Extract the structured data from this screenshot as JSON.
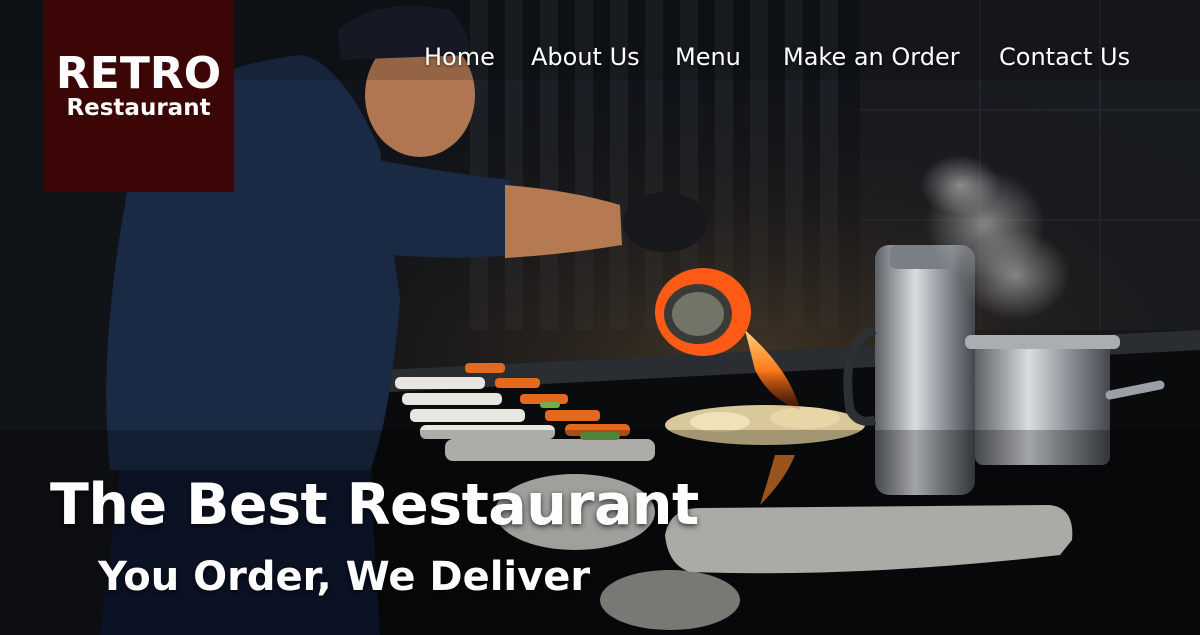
{
  "brand": {
    "line1": "RETRO",
    "line2": "Restaurant",
    "background": "#3d0606"
  },
  "nav": {
    "items": [
      {
        "label": "Home"
      },
      {
        "label": "About Us"
      },
      {
        "label": "Menu"
      },
      {
        "label": "Make an Order"
      },
      {
        "label": "Contact Us"
      }
    ]
  },
  "hero": {
    "headline": "The Best Restaurant",
    "tagline": "You Order, We Deliver",
    "image_subject": "chef-flambeing-dishes-in-kitchen"
  },
  "colors": {
    "text": "#ffffff",
    "flame": "#ff6a1a"
  }
}
